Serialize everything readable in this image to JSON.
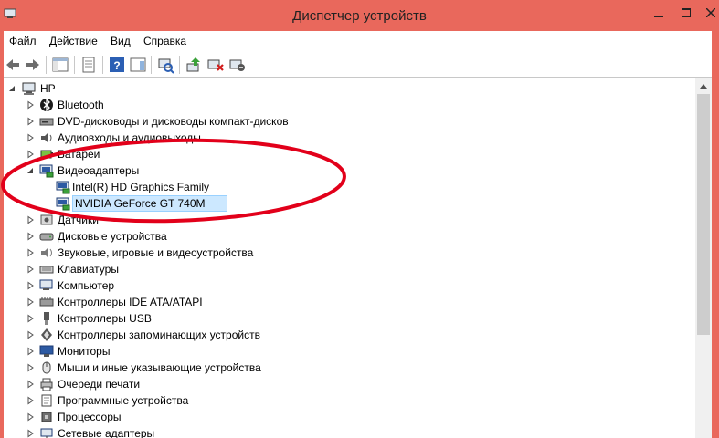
{
  "window": {
    "title": "Диспетчер устройств"
  },
  "menu": [
    "Файл",
    "Действие",
    "Вид",
    "Справка"
  ],
  "tree": {
    "root": "HP",
    "items": [
      {
        "label": "Bluetooth",
        "icon": "bluetooth-icon",
        "expanded": false
      },
      {
        "label": "DVD-дисководы и дисководы компакт-дисков",
        "icon": "dvd-drive-icon",
        "expanded": false
      },
      {
        "label": "Аудиовходы и аудиовыходы",
        "icon": "audio-io-icon",
        "expanded": false
      },
      {
        "label": "Батареи",
        "icon": "battery-icon",
        "expanded": false
      },
      {
        "label": "Видеоадаптеры",
        "icon": "display-adapter-icon",
        "expanded": true,
        "children": [
          {
            "label": "Intel(R) HD Graphics Family",
            "icon": "display-adapter-icon",
            "selected": false
          },
          {
            "label": "NVIDIA GeForce GT 740M",
            "icon": "display-adapter-icon",
            "selected": true
          }
        ]
      },
      {
        "label": "Датчики",
        "icon": "sensor-icon",
        "expanded": false
      },
      {
        "label": "Дисковые устройства",
        "icon": "disk-drive-icon",
        "expanded": false
      },
      {
        "label": "Звуковые, игровые и видеоустройства",
        "icon": "sound-icon",
        "expanded": false
      },
      {
        "label": "Клавиатуры",
        "icon": "keyboard-icon",
        "expanded": false
      },
      {
        "label": "Компьютер",
        "icon": "computer-icon",
        "expanded": false
      },
      {
        "label": "Контроллеры IDE ATA/ATAPI",
        "icon": "ide-controller-icon",
        "expanded": false
      },
      {
        "label": "Контроллеры USB",
        "icon": "usb-icon",
        "expanded": false
      },
      {
        "label": "Контроллеры запоминающих устройств",
        "icon": "storage-controller-icon",
        "expanded": false
      },
      {
        "label": "Мониторы",
        "icon": "monitor-icon",
        "expanded": false
      },
      {
        "label": "Мыши и иные указывающие устройства",
        "icon": "mouse-icon",
        "expanded": false
      },
      {
        "label": "Очереди печати",
        "icon": "printer-icon",
        "expanded": false
      },
      {
        "label": "Программные устройства",
        "icon": "software-device-icon",
        "expanded": false
      },
      {
        "label": "Процессоры",
        "icon": "processor-icon",
        "expanded": false
      },
      {
        "label": "Сетевые адаптеры",
        "icon": "network-adapter-icon",
        "expanded": false
      }
    ]
  },
  "colors": {
    "titlebar": "#e9685c",
    "selection": "#cce8ff",
    "annotation": "#e2001a"
  }
}
